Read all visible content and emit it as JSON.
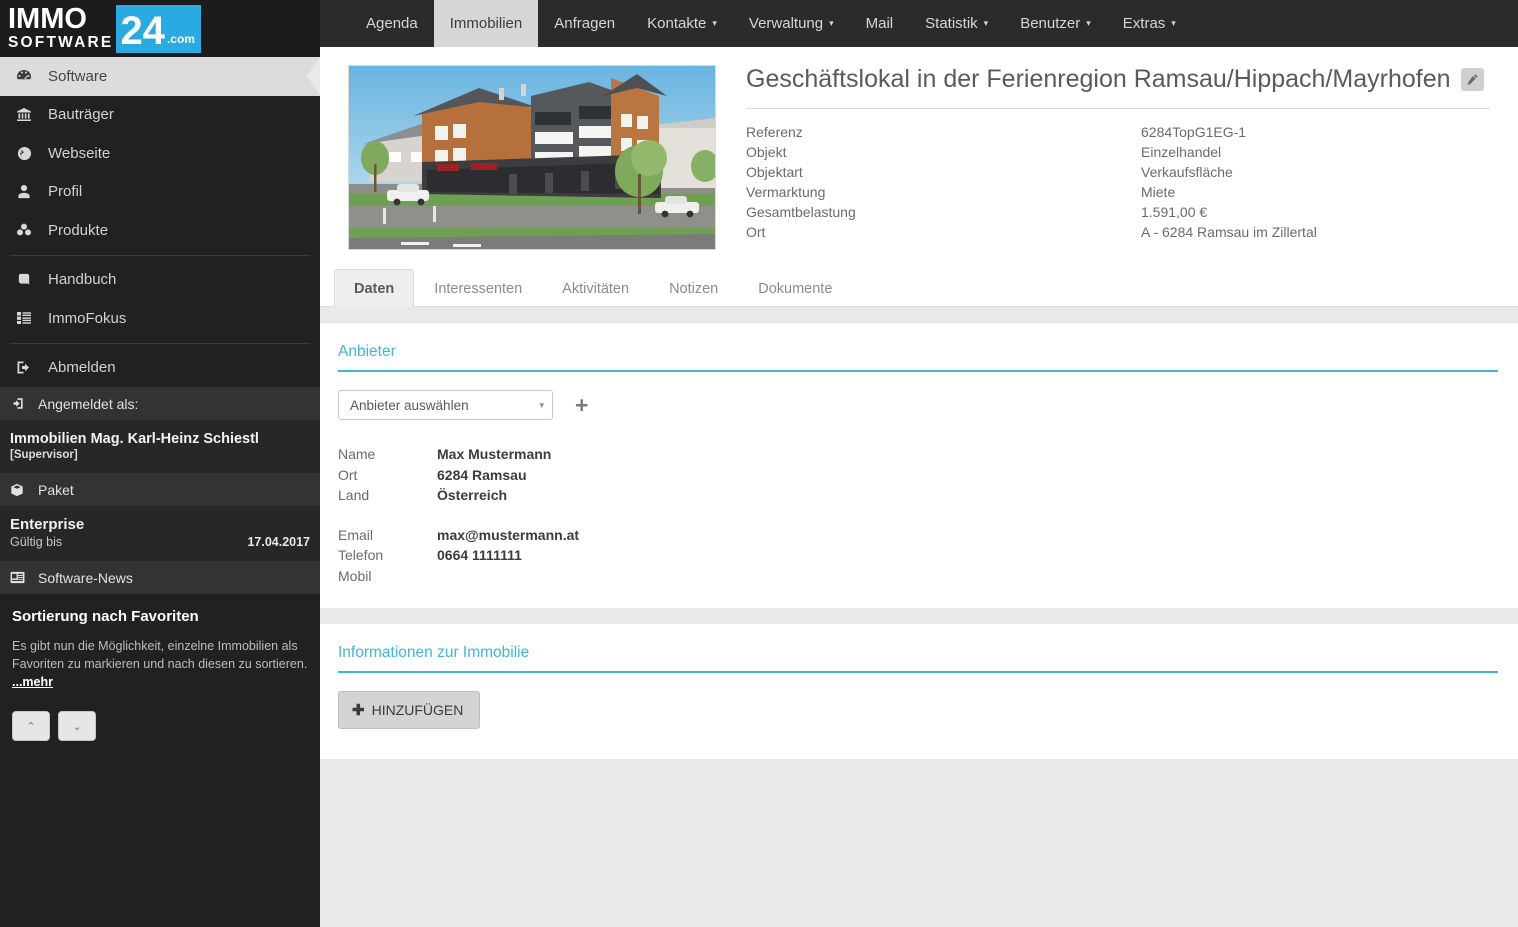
{
  "brand": {
    "immo": "IMMO",
    "software": "SOFTWARE",
    "badge_number": "24",
    "badge_com": ".com",
    "badge_color": "#29abe2"
  },
  "topnav": {
    "items": [
      {
        "label": "Agenda",
        "has_caret": false,
        "active": false
      },
      {
        "label": "Immobilien",
        "has_caret": false,
        "active": true
      },
      {
        "label": "Anfragen",
        "has_caret": false,
        "active": false
      },
      {
        "label": "Kontakte",
        "has_caret": true,
        "active": false
      },
      {
        "label": "Verwaltung",
        "has_caret": true,
        "active": false
      },
      {
        "label": "Mail",
        "has_caret": false,
        "active": false
      },
      {
        "label": "Statistik",
        "has_caret": true,
        "active": false
      },
      {
        "label": "Benutzer",
        "has_caret": true,
        "active": false
      },
      {
        "label": "Extras",
        "has_caret": true,
        "active": false
      }
    ],
    "caret_glyph": "▾"
  },
  "sidebar": {
    "items": [
      {
        "label": "Software",
        "icon": "dashboard-icon",
        "active": true
      },
      {
        "label": "Bauträger",
        "icon": "bank-icon",
        "active": false
      },
      {
        "label": "Webseite",
        "icon": "globe-icon",
        "active": false
      },
      {
        "label": "Profil",
        "icon": "user-icon",
        "active": false
      },
      {
        "label": "Produkte",
        "icon": "cubes-icon",
        "active": false
      },
      {
        "label": "Handbuch",
        "icon": "book-icon",
        "active": false
      },
      {
        "label": "ImmoFokus",
        "icon": "list-icon",
        "active": false
      },
      {
        "label": "Abmelden",
        "icon": "sign-out-icon",
        "active": false
      }
    ],
    "account": {
      "header": "Angemeldet als:",
      "name": "Immobilien Mag. Karl-Heinz Schiestl",
      "role": "[Supervisor]"
    },
    "paket": {
      "header": "Paket",
      "name": "Enterprise",
      "valid_label": "Gültig bis",
      "valid_date": "17.04.2017"
    },
    "news": {
      "header": "Software-News",
      "title": "Sortierung nach Favoriten",
      "text": "Es gibt nun die Möglichkeit, einzelne Immobilien als Favoriten zu markieren und nach diesen zu sortieren. ",
      "more": "...mehr",
      "prev_glyph": "⌃",
      "next_glyph": "⌄"
    }
  },
  "property": {
    "title": "Geschäftslokal in der Ferienregion Ramsau/Hippach/Mayrhofen",
    "edit_icon": "pencil-icon",
    "specs": [
      {
        "key": "Referenz",
        "value": "6284TopG1EG-1"
      },
      {
        "key": "Objekt",
        "value": "Einzelhandel"
      },
      {
        "key": "Objektart",
        "value": "Verkaufsfläche"
      },
      {
        "key": "Vermarktung",
        "value": "Miete"
      },
      {
        "key": "Gesamtbelastung",
        "value": "1.591,00 €"
      },
      {
        "key": "Ort",
        "value": "A - 6284 Ramsau im Zillertal"
      }
    ]
  },
  "tabs": [
    {
      "label": "Daten",
      "active": true
    },
    {
      "label": "Interessenten",
      "active": false
    },
    {
      "label": "Aktivitäten",
      "active": false
    },
    {
      "label": "Notizen",
      "active": false
    },
    {
      "label": "Dokumente",
      "active": false
    }
  ],
  "anbieter": {
    "section_title": "Anbieter",
    "select_value": "Anbieter auswählen",
    "select_caret": "▾",
    "add_icon": "plus-icon",
    "fields": [
      {
        "key": "Name",
        "value": "Max Mustermann"
      },
      {
        "key": "Ort",
        "value": "6284 Ramsau"
      },
      {
        "key": "Land",
        "value": "Österreich"
      }
    ],
    "contact": [
      {
        "key": "Email",
        "value": "max@mustermann.at"
      },
      {
        "key": "Telefon",
        "value": "0664 1111111"
      },
      {
        "key": "Mobil",
        "value": ""
      }
    ]
  },
  "informationen": {
    "section_title": "Informationen zur Immobilie",
    "add_button": "HINZUFÜGEN",
    "add_button_plus": "✚"
  },
  "accent_color": "#3fb6d8"
}
